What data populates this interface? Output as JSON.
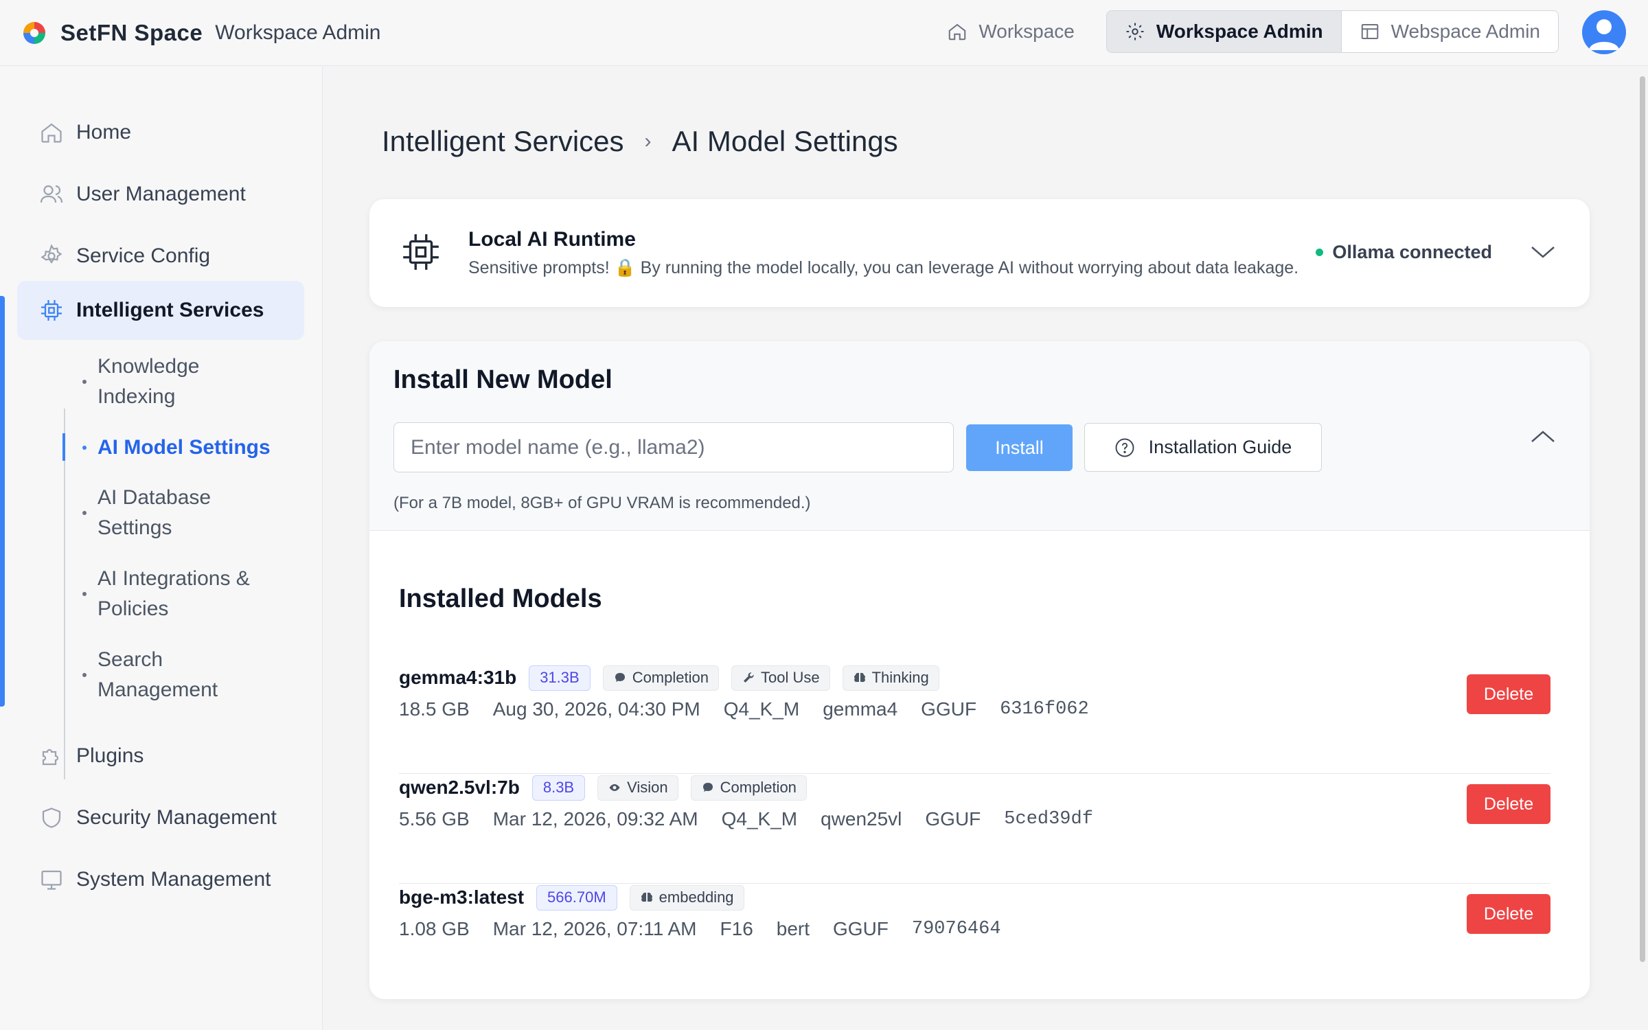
{
  "app": {
    "brand": "SetFN Space",
    "section": "Workspace Admin"
  },
  "topnav": {
    "workspace": "Workspace",
    "workspace_admin": "Workspace Admin",
    "webspace_admin": "Webspace Admin"
  },
  "sidebar": {
    "items": [
      {
        "label": "Home",
        "icon": "home-icon"
      },
      {
        "label": "User Management",
        "icon": "users-icon"
      },
      {
        "label": "Service Config",
        "icon": "gear-icon"
      },
      {
        "label": "Intelligent Services",
        "icon": "chip-icon"
      },
      {
        "label": "Plugins",
        "icon": "puzzle-icon"
      },
      {
        "label": "Security Management",
        "icon": "shield-icon"
      },
      {
        "label": "System Management",
        "icon": "monitor-icon"
      }
    ],
    "sub_items": [
      {
        "label": "Knowledge Indexing"
      },
      {
        "label": "AI Model Settings"
      },
      {
        "label": "AI Database Settings"
      },
      {
        "label": "AI Integrations & Policies"
      },
      {
        "label": "Search Management"
      }
    ],
    "accent_color": "#3b82f6"
  },
  "breadcrumb": {
    "parent": "Intelligent Services",
    "current": "AI Model Settings"
  },
  "runtime": {
    "title": "Local AI Runtime",
    "subtitle": "Sensitive prompts! 🔒 By running the model locally, you can leverage AI without worrying about data leakage.",
    "status": "Ollama connected",
    "status_color": "#10b981"
  },
  "install": {
    "title": "Install New Model",
    "placeholder": "Enter model name (e.g., llama2)",
    "install_label": "Install",
    "guide_label": "Installation Guide",
    "hint": "(For a 7B model, 8GB+ of GPU VRAM is recommended.)"
  },
  "installed": {
    "title": "Installed Models",
    "delete_label": "Delete",
    "models": [
      {
        "name": "gemma4:31b",
        "params": "31.3B",
        "caps": [
          {
            "label": "Completion",
            "icon": "chat-icon"
          },
          {
            "label": "Tool Use",
            "icon": "wrench-icon"
          },
          {
            "label": "Thinking",
            "icon": "brain-icon"
          }
        ],
        "size": "18.5 GB",
        "date": "Aug 30, 2026, 04:30 PM",
        "quant": "Q4_K_M",
        "family": "gemma4",
        "format": "GGUF",
        "digest": "6316f062"
      },
      {
        "name": "qwen2.5vl:7b",
        "params": "8.3B",
        "caps": [
          {
            "label": "Vision",
            "icon": "eye-icon"
          },
          {
            "label": "Completion",
            "icon": "chat-icon"
          }
        ],
        "size": "5.56 GB",
        "date": "Mar 12, 2026, 09:32 AM",
        "quant": "Q4_K_M",
        "family": "qwen25vl",
        "format": "GGUF",
        "digest": "5ced39df"
      },
      {
        "name": "bge-m3:latest",
        "params": "566.70M",
        "caps": [
          {
            "label": "embedding",
            "icon": "brain-icon"
          }
        ],
        "size": "1.08 GB",
        "date": "Mar 12, 2026, 07:11 AM",
        "quant": "F16",
        "family": "bert",
        "format": "GGUF",
        "digest": "79076464"
      }
    ]
  }
}
